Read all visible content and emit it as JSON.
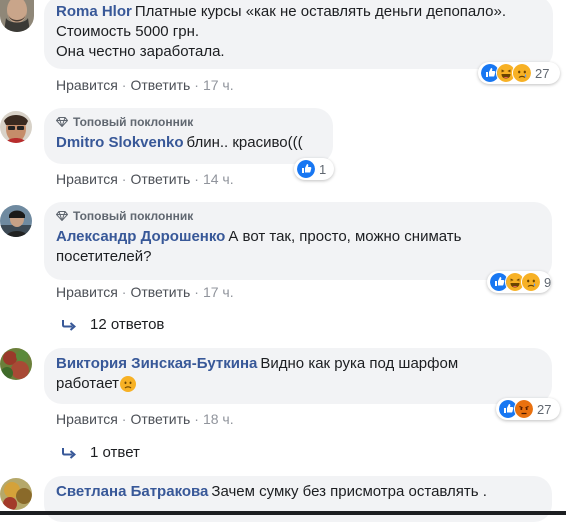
{
  "actions": {
    "like": "Нравится",
    "reply": "Ответить",
    "sep": "·"
  },
  "comments": [
    {
      "author": "Roma Hlor",
      "lines": [
        "Платные курсы «как не оставлять деньги депопало».",
        "Стоимость 5000 грн.",
        "Она честно заработала."
      ],
      "time": "17 ч.",
      "reactions": {
        "icons": [
          "like-icon",
          "haha-icon",
          "sad-icon"
        ],
        "count": "27"
      }
    },
    {
      "badge": "Топовый поклонник",
      "author": "Dmitro Slokvenko",
      "text": "блин.. красиво(((",
      "time": "14 ч.",
      "reactions": {
        "icons": [
          "like-icon"
        ],
        "count": "1"
      }
    },
    {
      "badge": "Топовый поклонник",
      "author": "Александр Дорошенко",
      "text1": "А вот так, просто, можно снимать",
      "text2": "посетителей?",
      "time": "17 ч.",
      "reactions": {
        "icons": [
          "like-icon",
          "haha-icon",
          "sad-icon"
        ],
        "count": "9"
      },
      "replies": "12 ответов"
    },
    {
      "author": "Виктория Зинская-Буткина",
      "text1": "Видно как рука под шарфом",
      "text2": "работает",
      "emoji": "frown-emoji",
      "time": "18 ч.",
      "reactions": {
        "icons": [
          "like-icon",
          "angry-icon"
        ],
        "count": "27"
      },
      "replies": "1 ответ"
    },
    {
      "author": "Светлана Батракова",
      "text": "Зачем сумку без присмотра оставлять ."
    }
  ],
  "colors": {
    "link": "#385898",
    "like": "#1877f2",
    "yellow": "#f7b125",
    "angry": "#e9710f"
  }
}
